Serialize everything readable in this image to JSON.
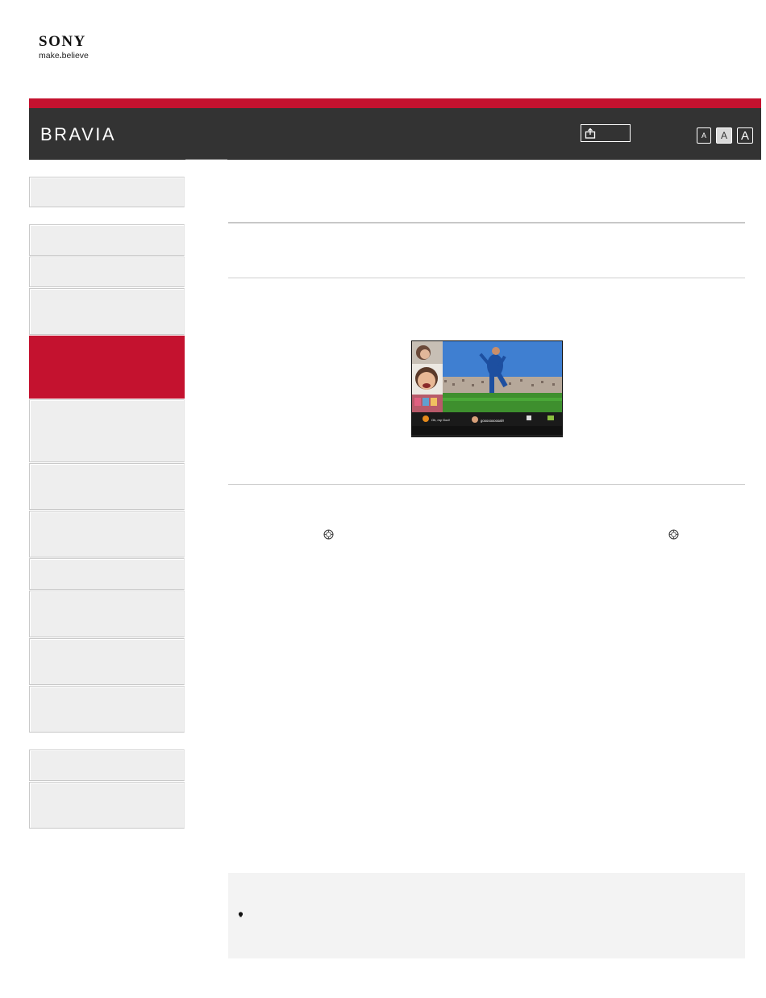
{
  "logo": {
    "brand": "SONY",
    "tagline_pre": "make",
    "tagline_dot": ".",
    "tagline_post": "believe"
  },
  "header": {
    "product": "BRAVIA"
  },
  "font_size_buttons": {
    "small": "A",
    "medium": "A",
    "large": "A"
  },
  "colors": {
    "accent": "#c4122f",
    "header_bg": "#333333",
    "nav_bg": "#eeeeee",
    "note_bg": "#f3f3f3"
  },
  "icons": [
    "share-icon",
    "enter-button-icon",
    "enter-button-icon",
    "note-bullet-icon"
  ],
  "tv_screen": {
    "left_caption": "Oh, my God!",
    "right_caption": "goooooooooal!!"
  }
}
